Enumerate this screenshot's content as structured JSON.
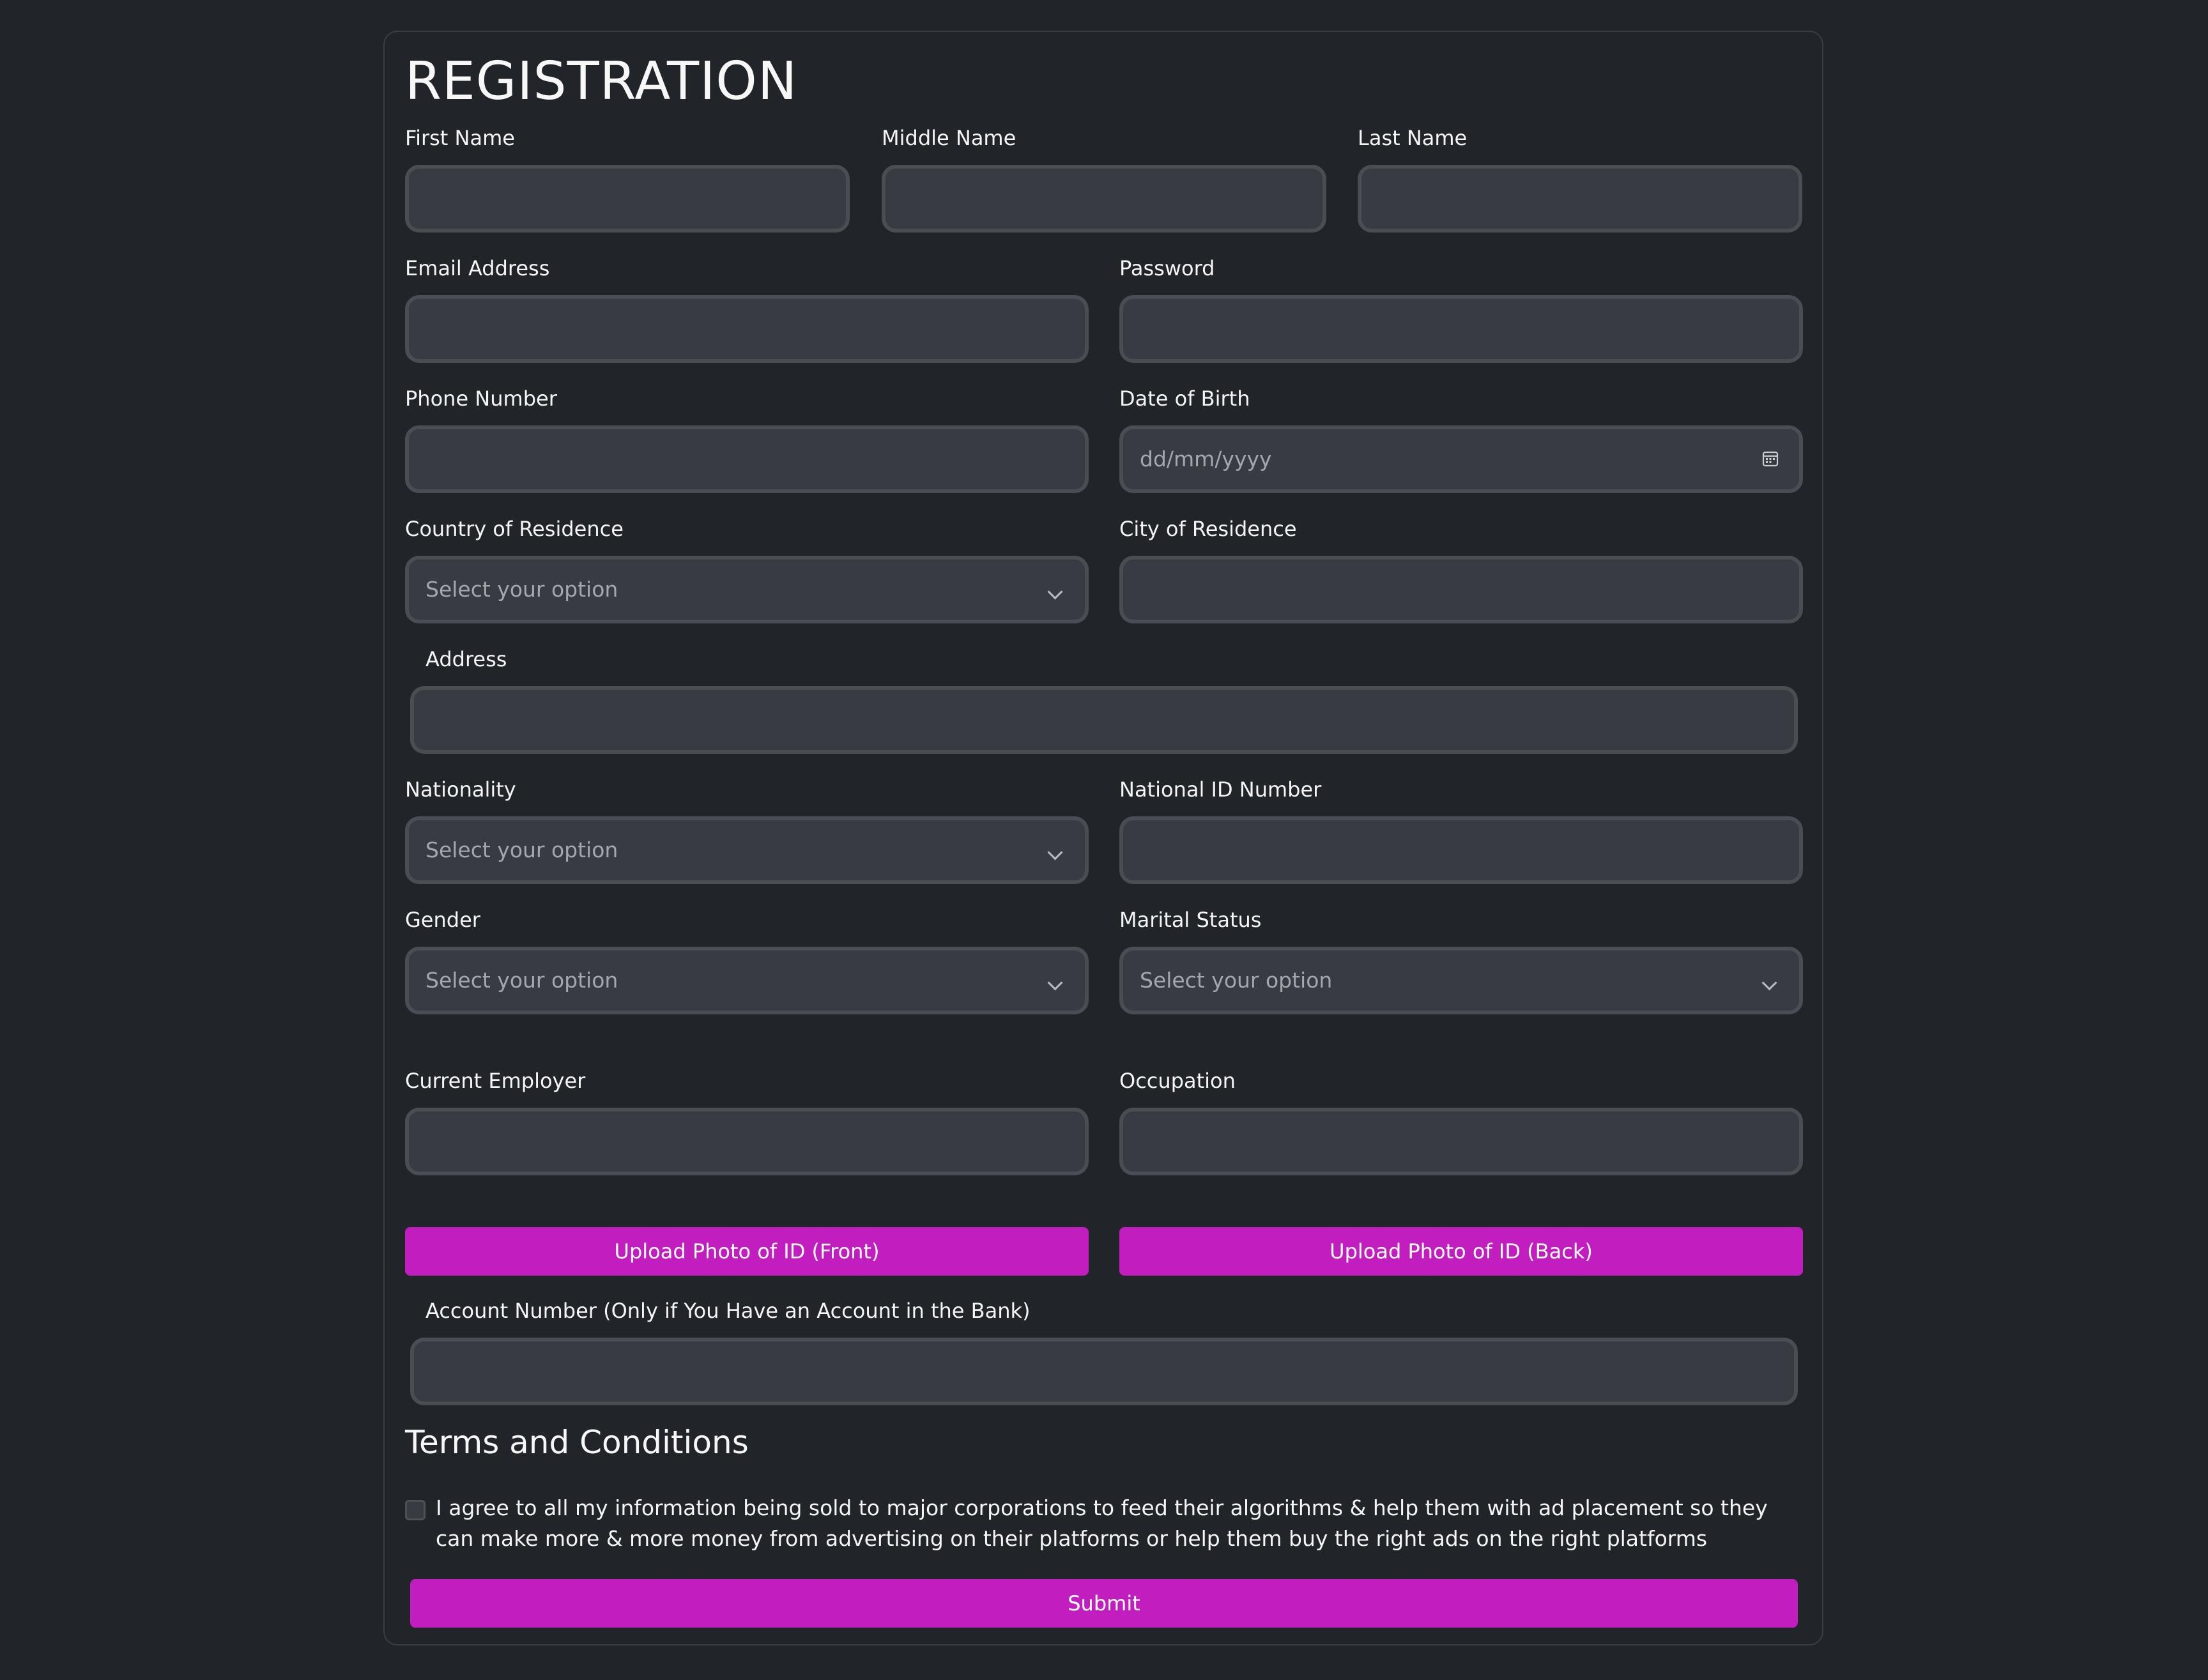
{
  "form": {
    "title": "REGISTRATION",
    "fields": {
      "first_name": {
        "label": "First Name",
        "value": ""
      },
      "middle_name": {
        "label": "Middle Name",
        "value": ""
      },
      "last_name": {
        "label": "Last Name",
        "value": ""
      },
      "email": {
        "label": "Email Address",
        "value": ""
      },
      "password": {
        "label": "Password",
        "value": ""
      },
      "phone": {
        "label": "Phone Number",
        "value": ""
      },
      "dob": {
        "label": "Date of Birth",
        "placeholder": "dd/mm/yyyy"
      },
      "country": {
        "label": "Country of Residence",
        "selected": "Select your option"
      },
      "city": {
        "label": "City of Residence",
        "value": ""
      },
      "address": {
        "label": "Address",
        "value": ""
      },
      "nationality": {
        "label": "Nationality",
        "selected": "Select your option"
      },
      "national_id": {
        "label": "National ID Number",
        "value": ""
      },
      "gender": {
        "label": "Gender",
        "selected": "Select your option"
      },
      "marital_status": {
        "label": "Marital Status",
        "selected": "Select your option"
      },
      "employer": {
        "label": "Current Employer",
        "value": ""
      },
      "occupation": {
        "label": "Occupation",
        "value": ""
      },
      "account_number": {
        "label": "Account Number (Only if You Have an Account in the Bank)",
        "value": ""
      }
    },
    "upload_front_label": "Upload Photo of ID (Front)",
    "upload_back_label": "Upload Photo of ID (Back)",
    "terms": {
      "title": "Terms and Conditions",
      "checked": false,
      "text": "I agree to all my information being sold to major corporations to feed their algorithms & help them with ad placement so they can make more & more money from advertising on their platforms or help them buy the right ads on the right platforms"
    },
    "submit_label": "Submit"
  },
  "colors": {
    "background": "#212429",
    "field_background": "#383b42",
    "field_border": "#4a4d54",
    "accent": "#c21ebf",
    "text": "#f4f5f7",
    "placeholder": "#a4a7ad"
  },
  "icons": {
    "date_picker": "calendar-icon",
    "select": "chevron-down-icon"
  }
}
